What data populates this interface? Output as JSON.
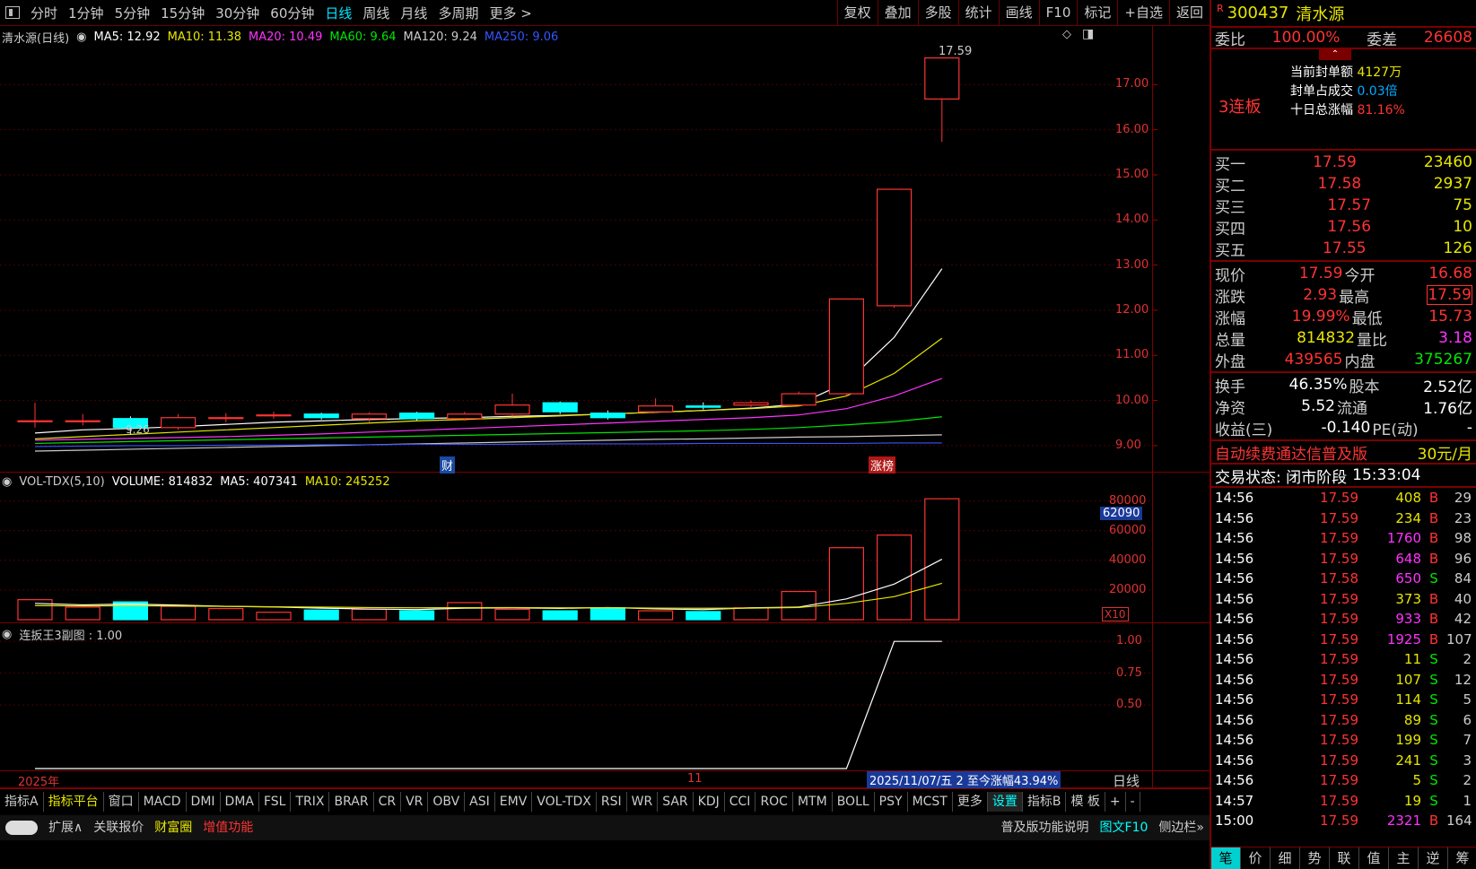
{
  "toolbar": {
    "periods": [
      "分时",
      "1分钟",
      "5分钟",
      "15分钟",
      "30分钟",
      "60分钟",
      "日线",
      "周线",
      "月线",
      "多周期",
      "更多 >"
    ],
    "active_period": "日线",
    "tools": [
      "复权",
      "叠加",
      "多股",
      "统计",
      "画线",
      "F10",
      "标记",
      "+自选",
      "返回"
    ]
  },
  "main_chart": {
    "title": "清水源(日线)",
    "ma": [
      {
        "label": "MA5: 12.92",
        "color": "#ffffff"
      },
      {
        "label": "MA10: 11.38",
        "color": "#e6e600"
      },
      {
        "label": "MA20: 10.49",
        "color": "#ff33ff"
      },
      {
        "label": "MA60: 9.64",
        "color": "#00e600"
      },
      {
        "label": "MA120: 9.24",
        "color": "#cccccc"
      },
      {
        "label": "MA250: 9.06",
        "color": "#3355ff"
      }
    ],
    "y_ticks": [
      "17.00",
      "16.00",
      "15.00",
      "14.00",
      "13.00",
      "12.00",
      "11.00",
      "10.00",
      "9.00"
    ],
    "high_label": "17.59",
    "low_label": "9.26",
    "markers": [
      "财",
      "涨榜"
    ]
  },
  "volume_pane": {
    "title": "VOL-TDX(5,10)",
    "volume": "VOLUME: 814832",
    "ma5": "MA5: 407341",
    "ma10": "MA10: 245252",
    "y_ticks": [
      "80000",
      "60000",
      "40000",
      "20000"
    ],
    "cursor_value": "62090",
    "unit": "X10"
  },
  "sub_pane": {
    "title": "连扳王3副图 : 1.00",
    "y_ticks": [
      "1.00",
      "0.75",
      "0.50"
    ]
  },
  "date_axis": {
    "year": "2025年",
    "month": "11",
    "status": "2025/11/07/五  2 至今涨幅43.94%",
    "right_label": "日线"
  },
  "indicator_tabs": [
    "指标A",
    "指标平台",
    "窗口",
    "MACD",
    "DMI",
    "DMA",
    "FSL",
    "TRIX",
    "BRAR",
    "CR",
    "VR",
    "OBV",
    "ASI",
    "EMV",
    "VOL-TDX",
    "RSI",
    "WR",
    "SAR",
    "KDJ",
    "CCI",
    "ROC",
    "MTM",
    "BOLL",
    "PSY",
    "MCST",
    "更多",
    "设置",
    "指标B",
    "模 板",
    "+",
    "-"
  ],
  "bottom_tabs": [
    "扩展∧",
    "关联报价",
    "财富圈",
    "增值功能",
    "普及版功能说明",
    "图文F10",
    "侧边栏»"
  ],
  "quote": {
    "code": "300437",
    "name": "清水源",
    "weibi_label": "委比",
    "weibi": "100.00%",
    "weicha_label": "委差",
    "weicha": "26608",
    "limit_up_tag": "3连板",
    "seal_amount_label": "当前封单额",
    "seal_amount": "4127万",
    "seal_ratio_label": "封单占成交",
    "seal_ratio": "0.03倍",
    "ten_day_label": "十日总涨幅",
    "ten_day": "81.16%",
    "bids": [
      {
        "label": "买一",
        "price": "17.59",
        "vol": "23460"
      },
      {
        "label": "买二",
        "price": "17.58",
        "vol": "2937"
      },
      {
        "label": "买三",
        "price": "17.57",
        "vol": "75"
      },
      {
        "label": "买四",
        "price": "17.56",
        "vol": "10"
      },
      {
        "label": "买五",
        "price": "17.55",
        "vol": "126"
      }
    ],
    "stats": [
      {
        "l1": "现价",
        "v1": "17.59",
        "c1": "red",
        "l2": "今开",
        "v2": "16.68",
        "c2": "red"
      },
      {
        "l1": "涨跌",
        "v1": "2.93",
        "c1": "red",
        "l2": "最高",
        "v2": "17.59",
        "c2": "red"
      },
      {
        "l1": "涨幅",
        "v1": "19.99%",
        "c1": "red",
        "l2": "最低",
        "v2": "15.73",
        "c2": "red"
      },
      {
        "l1": "总量",
        "v1": "814832",
        "c1": "yellow",
        "l2": "量比",
        "v2": "3.18",
        "c2": "magenta"
      },
      {
        "l1": "外盘",
        "v1": "439565",
        "c1": "red",
        "l2": "内盘",
        "v2": "375267",
        "c2": "green"
      }
    ],
    "stats2": [
      {
        "l1": "换手",
        "v1": "46.35%",
        "l2": "股本",
        "v2": "2.52亿"
      },
      {
        "l1": "净资",
        "v1": "5.52",
        "l2": "流通",
        "v2": "1.76亿"
      },
      {
        "l1": "收益(三)",
        "v1": "-0.140",
        "l2": "PE(动)",
        "v2": "-"
      }
    ],
    "promo": "自动续费通达信普及版",
    "promo_price": "30元/月",
    "trade_state": "交易状态: 闭市阶段",
    "trade_time": "15:33:04",
    "ticks": [
      {
        "t": "14:56",
        "p": "17.59",
        "v": "408",
        "bs": "B",
        "n": "29",
        "vc": "yellow"
      },
      {
        "t": "14:56",
        "p": "17.59",
        "v": "234",
        "bs": "B",
        "n": "23",
        "vc": "yellow"
      },
      {
        "t": "14:56",
        "p": "17.59",
        "v": "1760",
        "bs": "B",
        "n": "98",
        "vc": "magenta"
      },
      {
        "t": "14:56",
        "p": "17.59",
        "v": "648",
        "bs": "B",
        "n": "96",
        "vc": "magenta"
      },
      {
        "t": "14:56",
        "p": "17.58",
        "v": "650",
        "bs": "S",
        "n": "84",
        "vc": "magenta"
      },
      {
        "t": "14:56",
        "p": "17.59",
        "v": "373",
        "bs": "B",
        "n": "40",
        "vc": "yellow"
      },
      {
        "t": "14:56",
        "p": "17.59",
        "v": "933",
        "bs": "B",
        "n": "42",
        "vc": "magenta"
      },
      {
        "t": "14:56",
        "p": "17.59",
        "v": "1925",
        "bs": "B",
        "n": "107",
        "vc": "magenta"
      },
      {
        "t": "14:56",
        "p": "17.59",
        "v": "11",
        "bs": "S",
        "n": "2",
        "vc": "yellow"
      },
      {
        "t": "14:56",
        "p": "17.59",
        "v": "107",
        "bs": "S",
        "n": "12",
        "vc": "yellow"
      },
      {
        "t": "14:56",
        "p": "17.59",
        "v": "114",
        "bs": "S",
        "n": "5",
        "vc": "yellow"
      },
      {
        "t": "14:56",
        "p": "17.59",
        "v": "89",
        "bs": "S",
        "n": "6",
        "vc": "yellow"
      },
      {
        "t": "14:56",
        "p": "17.59",
        "v": "199",
        "bs": "S",
        "n": "7",
        "vc": "yellow"
      },
      {
        "t": "14:56",
        "p": "17.59",
        "v": "241",
        "bs": "S",
        "n": "3",
        "vc": "yellow"
      },
      {
        "t": "14:56",
        "p": "17.59",
        "v": "5",
        "bs": "S",
        "n": "2",
        "vc": "yellow"
      },
      {
        "t": "14:57",
        "p": "17.59",
        "v": "19",
        "bs": "S",
        "n": "1",
        "vc": "yellow"
      },
      {
        "t": "15:00",
        "p": "17.59",
        "v": "2321",
        "bs": "B",
        "n": "164",
        "vc": "magenta"
      }
    ],
    "bottom_nav": [
      "笔",
      "价",
      "细",
      "势",
      "联",
      "值",
      "主",
      "逆",
      "筹"
    ]
  },
  "chart_data": {
    "type": "candlestick",
    "candles": [
      {
        "o": 9.55,
        "c": 9.55,
        "h": 9.95,
        "l": 9.4
      },
      {
        "o": 9.55,
        "c": 9.55,
        "h": 9.7,
        "l": 9.45
      },
      {
        "o": 9.6,
        "c": 9.4,
        "h": 9.65,
        "l": 9.26
      },
      {
        "o": 9.4,
        "c": 9.62,
        "h": 9.7,
        "l": 9.35
      },
      {
        "o": 9.62,
        "c": 9.62,
        "h": 9.72,
        "l": 9.52
      },
      {
        "o": 9.68,
        "c": 9.68,
        "h": 9.75,
        "l": 9.6
      },
      {
        "o": 9.7,
        "c": 9.62,
        "h": 9.73,
        "l": 9.58
      },
      {
        "o": 9.6,
        "c": 9.7,
        "h": 9.74,
        "l": 9.52
      },
      {
        "o": 9.72,
        "c": 9.6,
        "h": 9.75,
        "l": 9.56
      },
      {
        "o": 9.6,
        "c": 9.7,
        "h": 9.75,
        "l": 9.55
      },
      {
        "o": 9.7,
        "c": 9.9,
        "h": 10.15,
        "l": 9.65
      },
      {
        "o": 9.95,
        "c": 9.75,
        "h": 9.98,
        "l": 9.7
      },
      {
        "o": 9.72,
        "c": 9.62,
        "h": 9.78,
        "l": 9.58
      },
      {
        "o": 9.75,
        "c": 9.88,
        "h": 10.05,
        "l": 9.72
      },
      {
        "o": 9.88,
        "c": 9.85,
        "h": 9.96,
        "l": 9.8
      },
      {
        "o": 9.9,
        "c": 9.95,
        "h": 10.0,
        "l": 9.85
      },
      {
        "o": 9.9,
        "c": 10.15,
        "h": 10.2,
        "l": 9.88
      },
      {
        "o": 10.15,
        "c": 12.25,
        "h": 12.25,
        "l": 10.1
      },
      {
        "o": 12.1,
        "c": 14.68,
        "h": 14.68,
        "l": 12.05
      },
      {
        "o": 16.68,
        "c": 17.59,
        "h": 17.59,
        "l": 15.73
      }
    ],
    "ylim": [
      8.8,
      17.9
    ],
    "volumes": [
      13500,
      8500,
      12000,
      9000,
      7500,
      5000,
      6500,
      7000,
      6000,
      11500,
      7000,
      6000,
      8000,
      6000,
      5500,
      8000,
      19000,
      48500,
      57000,
      81483
    ],
    "volume_ylim": [
      0,
      87000
    ],
    "ma5_vol": [
      11000,
      10000,
      10500,
      9800,
      9000,
      8600,
      7800,
      7200,
      6800,
      7800,
      8000,
      7600,
      8200,
      7300,
      6800,
      8000,
      8500,
      14000,
      24000,
      40734
    ],
    "ma10_vol": [
      9500,
      9300,
      9400,
      9200,
      9000,
      8700,
      8500,
      8200,
      8000,
      8100,
      8200,
      8000,
      8100,
      7800,
      7700,
      7800,
      8200,
      11000,
      15500,
      24525
    ],
    "sub_signal": [
      0,
      0,
      0,
      0,
      0,
      0,
      0,
      0,
      0,
      0,
      0,
      0,
      0,
      0,
      0,
      0,
      0,
      0,
      1,
      1
    ],
    "sub_ylim": [
      0,
      1.1
    ]
  }
}
